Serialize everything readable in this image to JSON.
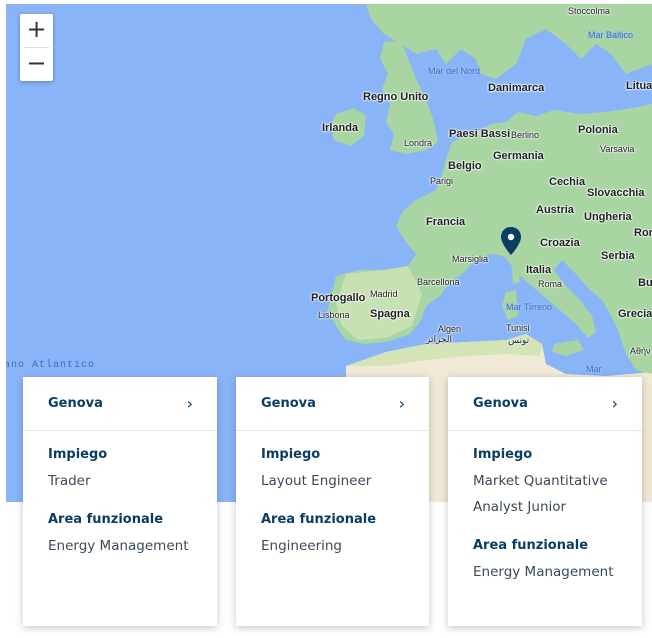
{
  "map": {
    "zoom_in": "+",
    "zoom_out": "−",
    "marker_city": "Genova",
    "labels": {
      "stoccolma": "Stoccolma",
      "mar_baltico": "Mar Baltico",
      "mar_del_nord": "Mar del Nord",
      "danimarca": "Danimarca",
      "litua": "Litua",
      "regno_unito": "Regno Unito",
      "irlanda": "Irlanda",
      "paesi_bassi": "Paesi Bassi",
      "berlino": "Berlino",
      "polonia": "Polonia",
      "londra": "Londra",
      "varsavia": "Varsavia",
      "belgio": "Belgio",
      "germania": "Germania",
      "parigi": "Parigi",
      "cechia": "Cechia",
      "slovacchia": "Slovacchia",
      "austria": "Austria",
      "francia": "Francia",
      "ungheria": "Ungheria",
      "croazia": "Croazia",
      "ron": "Ron",
      "marsiglia": "Marsiglia",
      "italia": "Italia",
      "serbia": "Serbia",
      "barcellona": "Barcellona",
      "roma": "Roma",
      "bu": "Bu",
      "portogallo": "Portogallo",
      "madrid": "Madrid",
      "mar_tirreno": "Mar Tirreno",
      "lisbona": "Lisbona",
      "spagna": "Spagna",
      "grecia": "Grecia",
      "algeri": "Algeri",
      "algeri_ar": "الجزائر",
      "tunisi": "Tunisi",
      "tunisi_ar": "تونس",
      "atene": "Aθήν",
      "ano_atlantico": "ano Atlantico",
      "mar": "Mar"
    }
  },
  "cards": [
    {
      "city": "Genova",
      "impiego_label": "Impiego",
      "impiego": "Trader",
      "area_label": "Area funzionale",
      "area": "Energy Management"
    },
    {
      "city": "Genova",
      "impiego_label": "Impiego",
      "impiego": "Layout Engineer",
      "area_label": "Area funzionale",
      "area": "Engineering"
    },
    {
      "city": "Genova",
      "impiego_label": "Impiego",
      "impiego": "Market Quantitative Analyst Junior",
      "area_label": "Area funzionale",
      "area": "Energy Management"
    }
  ],
  "colors": {
    "sea": "#8ab4f8",
    "land": "#a8d5a2",
    "desert": "#efe9d6",
    "brand": "#0b3d63",
    "pin": "#0b3d63"
  },
  "icons": {
    "chevron": "chevron-right-icon",
    "pin": "map-pin-icon"
  },
  "chevron_glyph": "›"
}
